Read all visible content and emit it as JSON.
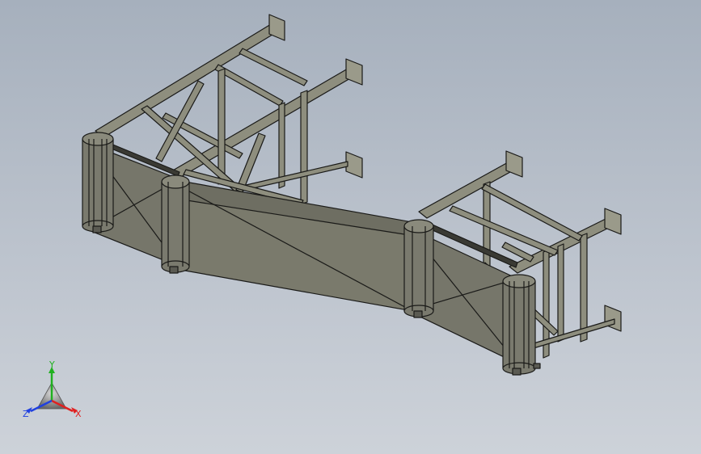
{
  "viewport": {
    "background_top": "#a6b0bd",
    "background_bottom": "#cdd2d9"
  },
  "model": {
    "frame_color": "#8a8a7a",
    "edge_color": "#1a1a18",
    "belt_color": "#76766a",
    "roller_color": "#7a7a6e"
  },
  "triad": {
    "x_label": "X",
    "y_label": "Y",
    "z_label": "Z",
    "x_color": "#e02020",
    "y_color": "#20b020",
    "z_color": "#2040e0"
  }
}
